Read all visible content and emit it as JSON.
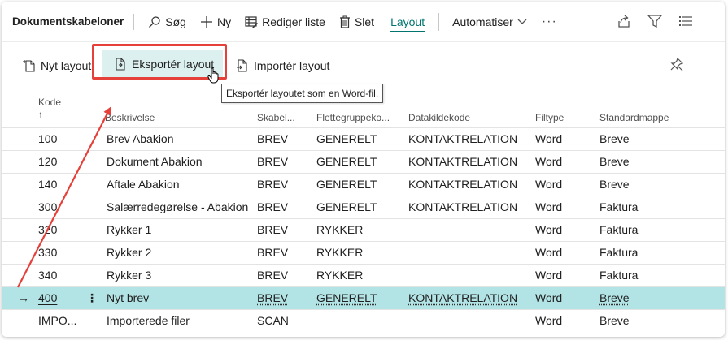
{
  "page": {
    "title": "Dokumentskabeloner"
  },
  "toolbar": {
    "search": "Søg",
    "new": "Ny",
    "edit_list": "Rediger liste",
    "delete": "Slet",
    "layout": "Layout",
    "automate": "Automatiser",
    "more": "···"
  },
  "layout_actions": {
    "new_layout": "Nyt layout",
    "export_layout": "Eksportér layout",
    "import_layout": "Importér layout",
    "export_tooltip": "Eksportér layoutet som en Word-fil."
  },
  "table": {
    "columns": {
      "code": "Kode",
      "sort_indicator": "↑",
      "description": "Beskrivelse",
      "template": "Skabel...",
      "merge_group": "Flettegruppeko...",
      "datasource": "Datakildekode",
      "filetype": "Filtype",
      "default_folder": "Standardmappe"
    },
    "rows": [
      {
        "code": "100",
        "description": "Brev Abakion",
        "template": "BREV",
        "merge_group": "GENERELT",
        "datasource": "KONTAKTRELATION",
        "filetype": "Word",
        "default_folder": "Breve"
      },
      {
        "code": "120",
        "description": "Dokument Abakion",
        "template": "BREV",
        "merge_group": "GENERELT",
        "datasource": "KONTAKTRELATION",
        "filetype": "Word",
        "default_folder": "Breve"
      },
      {
        "code": "140",
        "description": "Aftale Abakion",
        "template": "BREV",
        "merge_group": "GENERELT",
        "datasource": "KONTAKTRELATION",
        "filetype": "Word",
        "default_folder": "Breve"
      },
      {
        "code": "300",
        "description": "Salærredegørelse - Abakion",
        "template": "BREV",
        "merge_group": "GENERELT",
        "datasource": "KONTAKTRELATION",
        "filetype": "Word",
        "default_folder": "Faktura"
      },
      {
        "code": "320",
        "description": "Rykker 1",
        "template": "BREV",
        "merge_group": "RYKKER",
        "datasource": "",
        "filetype": "Word",
        "default_folder": "Faktura"
      },
      {
        "code": "330",
        "description": "Rykker 2",
        "template": "BREV",
        "merge_group": "RYKKER",
        "datasource": "",
        "filetype": "Word",
        "default_folder": "Faktura"
      },
      {
        "code": "340",
        "description": "Rykker 3",
        "template": "BREV",
        "merge_group": "RYKKER",
        "datasource": "",
        "filetype": "Word",
        "default_folder": "Faktura"
      },
      {
        "code": "400",
        "description": "Nyt brev",
        "template": "BREV",
        "merge_group": "GENERELT",
        "datasource": "KONTAKTRELATION",
        "filetype": "Word",
        "default_folder": "Breve",
        "selected": true
      },
      {
        "code": "IMPO...",
        "description": "Importerede filer",
        "template": "SCAN",
        "merge_group": "",
        "datasource": "",
        "filetype": "Word",
        "default_folder": "Breve"
      }
    ],
    "selected_row_marker": "→",
    "row_menu": "⋮"
  },
  "icons": {
    "search": "search-icon",
    "new": "plus-icon",
    "edit_list": "edit-list-icon",
    "delete": "trash-icon",
    "automate_chevron": "chevron-down-icon",
    "share": "share-icon",
    "filter": "filter-icon",
    "list_view": "list-view-icon",
    "new_layout": "new-document-icon",
    "export_layout": "export-document-icon",
    "import_layout": "import-document-icon",
    "pin": "pin-off-icon",
    "cursor": "hand-cursor-icon"
  },
  "colors": {
    "accent": "#00756f",
    "selected_row": "#b2e3e5",
    "export_hover": "#dcf0ef",
    "annotation_red": "#e5403a"
  }
}
